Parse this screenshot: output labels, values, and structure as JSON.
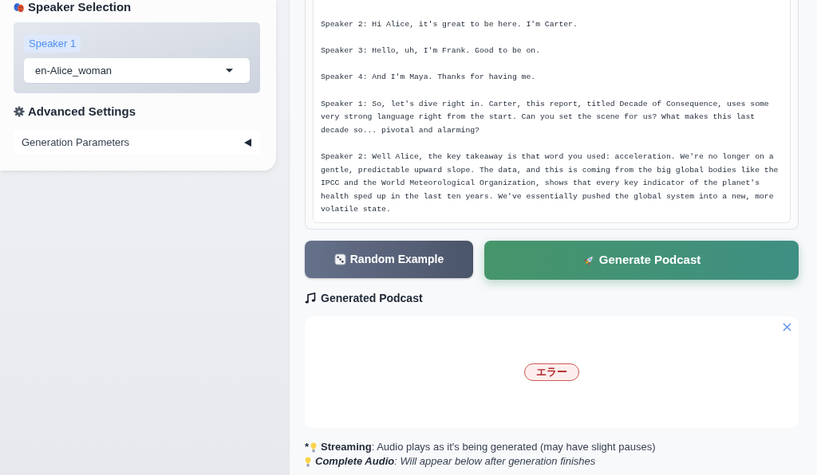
{
  "speaker_selection": {
    "title": "Speaker Selection",
    "speakers": [
      {
        "label": "Speaker 1",
        "voice": "en-Alice_woman"
      }
    ]
  },
  "advanced_settings": {
    "title": "Advanced Settings",
    "accordion": {
      "label": "Generation Parameters",
      "expanded": false
    }
  },
  "script": {
    "paragraphs": [
      "Speaker 2: Hi Alice, it's great to be here. I'm Carter.",
      "Speaker 3: Hello, uh, I'm Frank. Good to be on.",
      "Speaker 4: And I'm Maya. Thanks for having me.",
      "Speaker 1: So, let's dive right in. Carter, this report, titled Decade of Consequence, uses some very strong language right from the start. Can you set the scene for us? What makes this last decade so... pivotal and alarming?",
      "Speaker 2: Well Alice, the key takeaway is that word you used: acceleration. We're no longer on a gentle, predictable upward slope. The data, and this is coming from the big global bodies like the IPCC and the World Meteorological Organization, shows that every key indicator of the planet's health sped up in the last ten years. We've essentially pushed the global system into a new, more volatile state."
    ]
  },
  "buttons": [
    {
      "label": "Random Example",
      "kind": "random"
    },
    {
      "label": "Generate Podcast",
      "kind": "generate"
    }
  ],
  "output": {
    "title": "Generated Podcast",
    "status_badge": "エラー"
  },
  "notes": [
    {
      "prefix": "*",
      "text": "**Streaming**: Audio plays as it's being generated (may have slight pauses)",
      "italic": false
    },
    {
      "text": "**Complete Audio**: Will appear below after generation finishes",
      "italic": true
    }
  ]
}
